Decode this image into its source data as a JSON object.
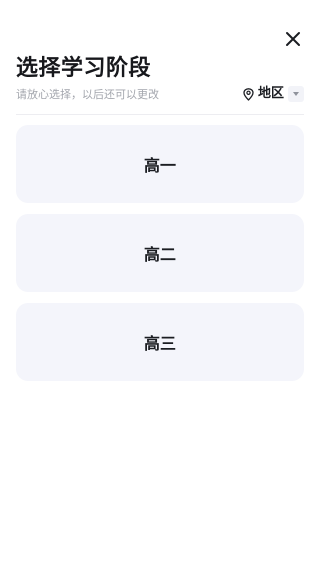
{
  "header": {
    "title": "选择学习阶段",
    "subtitle": "请放心选择，以后还可以更改",
    "close_icon": "close-icon"
  },
  "region": {
    "label": "地区",
    "icon": "location-pin-icon",
    "dropdown_icon": "caret-down-icon"
  },
  "options": [
    {
      "label": "高一"
    },
    {
      "label": "高二"
    },
    {
      "label": "高三"
    }
  ],
  "colors": {
    "card_background": "#f4f5fb",
    "text_primary": "#1b1d22",
    "text_secondary": "#a3a6ad",
    "divider": "#ededf1"
  }
}
